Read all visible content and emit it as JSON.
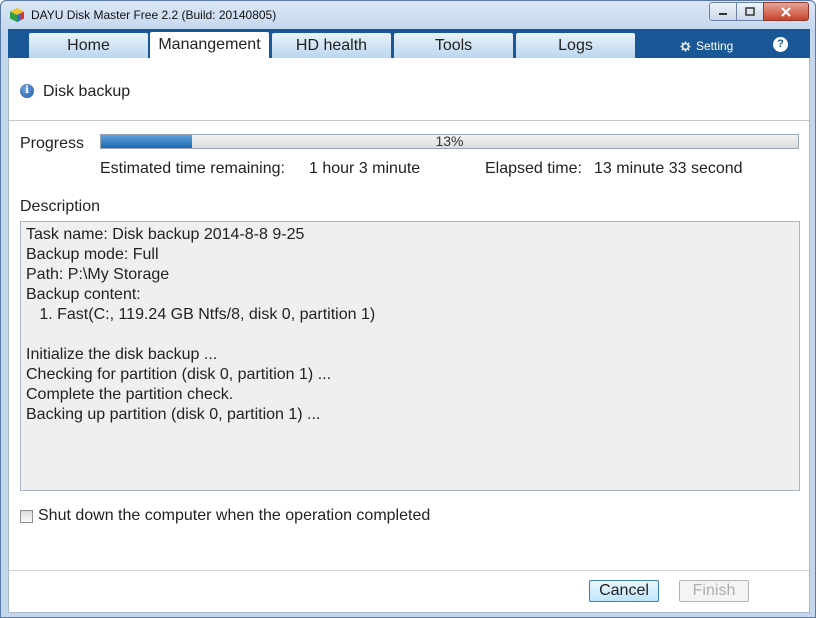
{
  "window": {
    "title": "DAYU Disk Master Free 2.2  (Build: 20140805)",
    "icon": "app-cube-icon",
    "controls": [
      "minimize-icon",
      "maximize-icon",
      "close-icon"
    ]
  },
  "nav": {
    "tabs": [
      {
        "label": "Home",
        "active": false
      },
      {
        "label": "Manangement",
        "active": true
      },
      {
        "label": "HD health",
        "active": false
      },
      {
        "label": "Tools",
        "active": false
      },
      {
        "label": "Logs",
        "active": false
      }
    ],
    "setting_label": "Setting",
    "help_label": "?"
  },
  "header": {
    "title": "Disk backup",
    "icon": "info-icon"
  },
  "progress": {
    "label": "Progress",
    "percent_text": "13%",
    "percent": 13,
    "remaining_label": "Estimated time remaining:",
    "remaining_value": "1 hour 3 minute",
    "elapsed_label": "Elapsed time:",
    "elapsed_value": "13 minute 33 second"
  },
  "description": {
    "label": "Description",
    "lines": [
      "Task name: Disk backup 2014-8-8 9-25",
      "Backup mode: Full",
      "Path: P:\\My Storage",
      "Backup content:",
      "   1. Fast(C:, 119.24 GB Ntfs/8, disk 0, partition 1)",
      "",
      "Initialize the disk backup ...",
      "Checking for partition (disk 0, partition 1) ...",
      "Complete the partition check.",
      "Backing up partition (disk 0, partition 1) ..."
    ]
  },
  "shutdown": {
    "label": "Shut down the computer when the operation completed",
    "checked": false
  },
  "buttons": {
    "cancel": "Cancel",
    "finish": "Finish"
  },
  "colors": {
    "nav_bg": "#1a5796",
    "progress_fill": "#1f69b3"
  }
}
